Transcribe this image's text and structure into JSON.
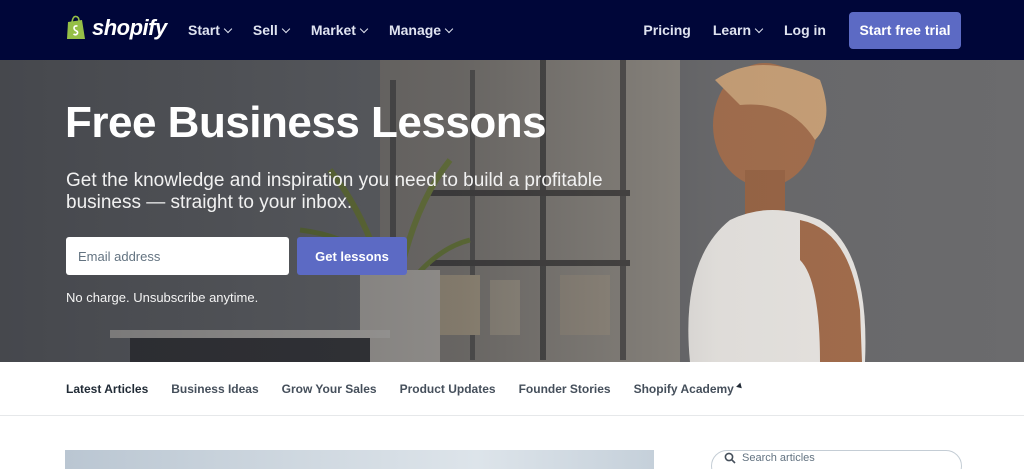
{
  "brand": {
    "name": "shopify"
  },
  "nav": {
    "left": [
      {
        "label": "Start",
        "has_dropdown": true
      },
      {
        "label": "Sell",
        "has_dropdown": true
      },
      {
        "label": "Market",
        "has_dropdown": true
      },
      {
        "label": "Manage",
        "has_dropdown": true
      }
    ],
    "right": {
      "pricing": "Pricing",
      "learn": "Learn",
      "login": "Log in",
      "cta": "Start free trial"
    }
  },
  "hero": {
    "title": "Free Business Lessons",
    "subtitle": "Get the knowledge and inspiration you need to build a profitable business — straight to your inbox.",
    "email_placeholder": "Email address",
    "button": "Get lessons",
    "note": "No charge. Unsubscribe anytime."
  },
  "subnav": {
    "items": [
      "Latest Articles",
      "Business Ideas",
      "Grow Your Sales",
      "Product Updates",
      "Founder Stories",
      "Shopify Academy"
    ],
    "active_index": 0
  },
  "search": {
    "placeholder": "Search articles"
  },
  "colors": {
    "nav_bg": "#000639",
    "accent": "#5c6ac4",
    "logo_green": "#95bf47"
  }
}
